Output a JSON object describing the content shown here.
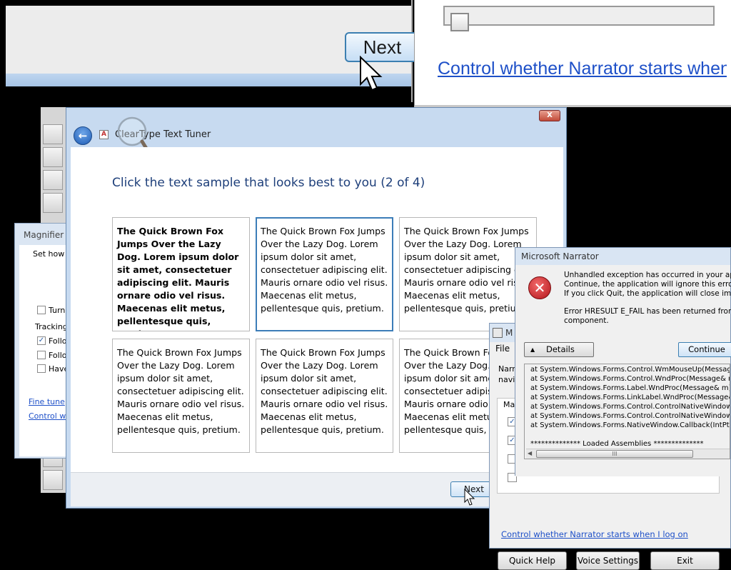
{
  "magnified": {
    "next_label": "Next",
    "link_text": "Control whether Narrator starts when I"
  },
  "magnifier": {
    "title": "Magnifier",
    "set_how": "Set how",
    "turn": "Turn",
    "tracking": "Tracking",
    "follow1": "Follo",
    "follow2": "Follo",
    "have": "Have",
    "fine_tune": "Fine tune",
    "control_link": "Control w"
  },
  "cleartype": {
    "close_icon": "X",
    "title": "ClearType Text Tuner",
    "heading": "Click the text sample that looks best to you (2 of 4)",
    "sample_text": "The Quick Brown Fox Jumps Over the Lazy Dog. Lorem ipsum dolor sit amet, consectetuer adipiscing elit. Mauris ornare odio vel risus. Maecenas elit metus, pellentesque quis, pretium.",
    "selected_index": 1,
    "next_label": "Next"
  },
  "narrator": {
    "title": "M",
    "menu_file": "File",
    "desc_line1": "Narr",
    "desc_line2": "navi",
    "group_label": "Ma",
    "link": "Control whether Narrator starts when I log on",
    "quick_help": "Quick Help",
    "voice_settings": "Voice Settings",
    "exit": "Exit"
  },
  "error_dialog": {
    "title": "Microsoft Narrator",
    "line1": "Unhandled exception has occurred in your appli",
    "line2": "Continue, the application will ignore this error ar",
    "line3": "If you click Quit, the application will close imme",
    "line4": "Error HRESULT E_FAIL has been returned from",
    "line5": "component.",
    "details_label": "Details",
    "continue_label": "Continue",
    "trace": [
      "at System.Windows.Forms.Control.WmMouseUp(Message&",
      "at System.Windows.Forms.Control.WndProc(Message& m)",
      "at System.Windows.Forms.Label.WndProc(Message& m)",
      "at System.Windows.Forms.LinkLabel.WndProc(Message& m",
      "at System.Windows.Forms.Control.ControlNativeWindow.On",
      "at System.Windows.Forms.Control.ControlNativeWindow.W",
      "at System.Windows.Forms.NativeWindow.Callback(IntPtr hV"
    ],
    "loaded_assemblies": "************** Loaded Assemblies **************",
    "scroll_thumb": "III"
  }
}
